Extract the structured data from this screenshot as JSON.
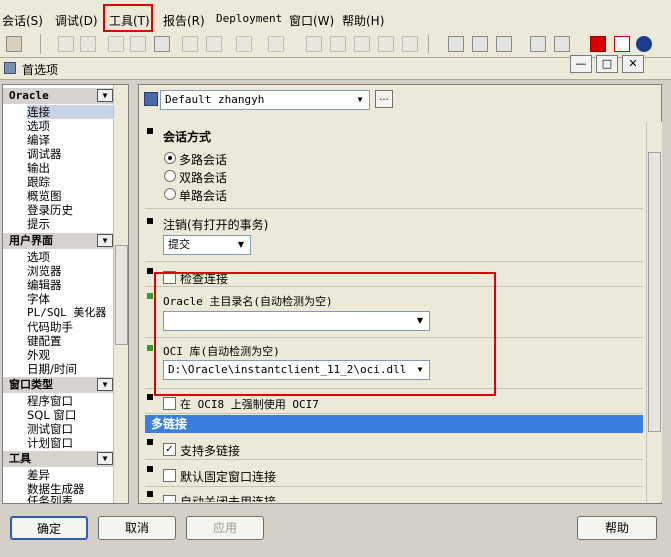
{
  "menu": [
    "会话(S)",
    "调试(D)",
    "工具(T)",
    "报告(R)",
    "Deployment",
    "窗口(W)",
    "帮助(H)"
  ],
  "window": {
    "title": "首选项",
    "controls": [
      "—",
      "□",
      "✕"
    ]
  },
  "left_nav": {
    "categories": [
      {
        "label": "Oracle",
        "items": [
          "连接",
          "选项",
          "编译",
          "调试器",
          "输出",
          "跟踪",
          "概览图",
          "登录历史",
          "提示"
        ]
      },
      {
        "label": "用户界面",
        "items": [
          "选项",
          "浏览器",
          "编辑器",
          "字体",
          "PL/SQL 美化器",
          "代码助手",
          "键配置",
          "外观",
          "日期/时间"
        ]
      },
      {
        "label": "窗口类型",
        "items": [
          "程序窗口",
          "SQL 窗口",
          "测试窗口",
          "计划窗口"
        ]
      },
      {
        "label": "工具",
        "items": [
          "差异",
          "数据生成器",
          "任务列表"
        ]
      }
    ],
    "selected": "连接"
  },
  "profile": {
    "value": "Default zhangyh",
    "more_label": "..."
  },
  "session_mode": {
    "title": "会话方式",
    "options": [
      "多路会话",
      "双路会话",
      "单路会话"
    ],
    "selected": "多路会话"
  },
  "logoff": {
    "title": "注销(有打开的事务)",
    "value": "提交"
  },
  "check_connection": {
    "label": "检查连接"
  },
  "oracle_home": {
    "title": "Oracle 主目录名(自动检测为空)",
    "value": ""
  },
  "oci_library": {
    "title": "OCI 库(自动检测为空)",
    "value": "D:\\Oracle\\instantclient_11_2\\oci.dll"
  },
  "force_oci7": {
    "label": "在 OCI8 上强制使用 OCI7"
  },
  "multi_connection": {
    "title": "多链接",
    "support_label": "支持多链接",
    "support_checked": true,
    "default_fixed_label": "默认固定窗口连接",
    "auto_close_label": "自动关闭未用连接"
  },
  "buttons": {
    "ok": "确定",
    "cancel": "取消",
    "apply": "应用",
    "help": "帮助"
  }
}
